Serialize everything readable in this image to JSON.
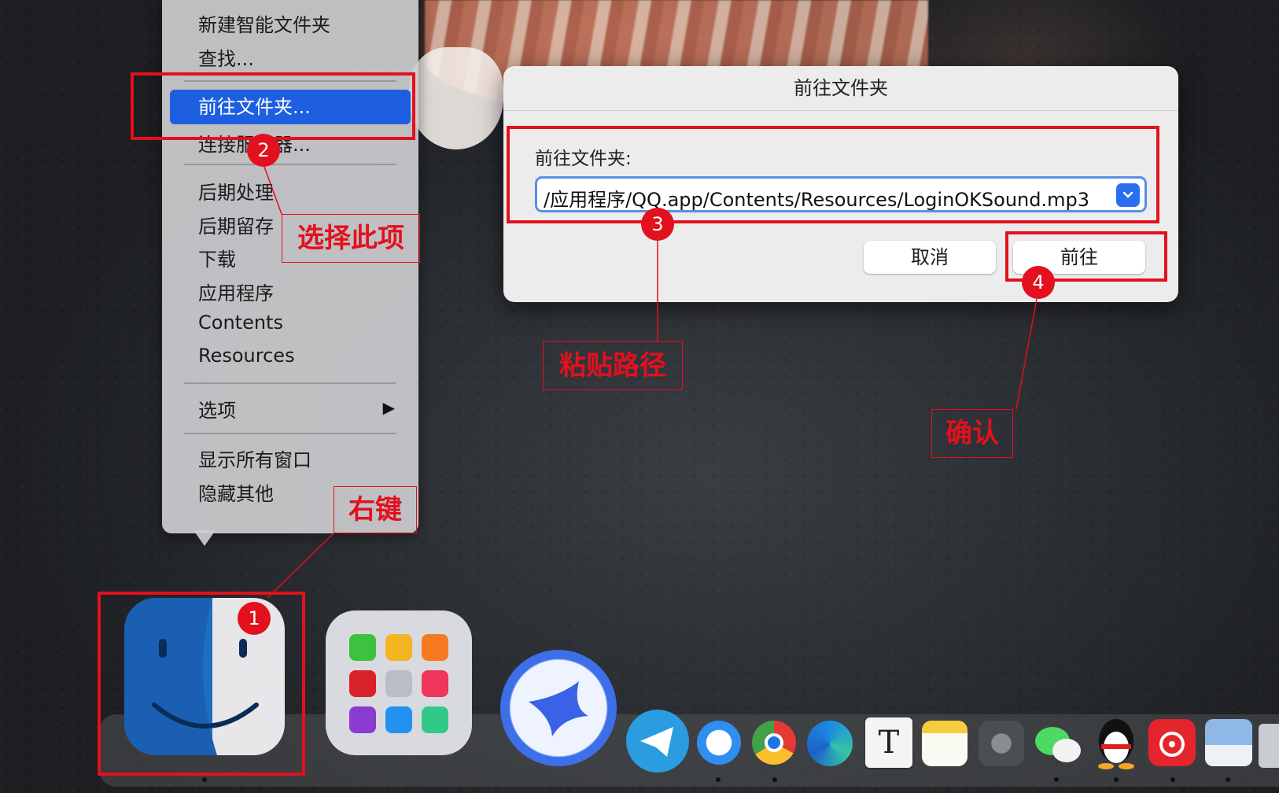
{
  "context_menu": {
    "items": [
      "新建智能文件夹",
      "查找...",
      "前往文件夹...",
      "连接服务器...",
      "后期处理",
      "后期留存",
      "下载",
      "应用程序",
      "Contents",
      "Resources",
      "选项",
      "显示所有窗口",
      "隐藏其他"
    ],
    "submenu_arrow": "▶"
  },
  "dialog": {
    "title": "前往文件夹",
    "label": "前往文件夹:",
    "path_value": "/应用程序/QQ.app/Contents/Resources/LoginOKSound.mp3",
    "cancel_label": "取消",
    "go_label": "前往"
  },
  "annotations": {
    "badges": [
      "1",
      "2",
      "3",
      "4"
    ],
    "right_click": "右键",
    "select_item": "选择此项",
    "paste_path": "粘贴路径",
    "confirm": "确认"
  },
  "dock": {
    "icons": [
      "finder-icon",
      "launchpad-icon",
      "feishu-icon",
      "telegram-icon",
      "safari-icon",
      "chrome-icon",
      "edge-icon",
      "typora-icon",
      "notes-icon",
      "system-preferences-icon",
      "wechat-icon",
      "qq-icon",
      "netease-music-icon",
      "preview-icon"
    ]
  },
  "colors": {
    "selection_blue": "#1d5fe0",
    "annotation_red": "#e3101e"
  }
}
